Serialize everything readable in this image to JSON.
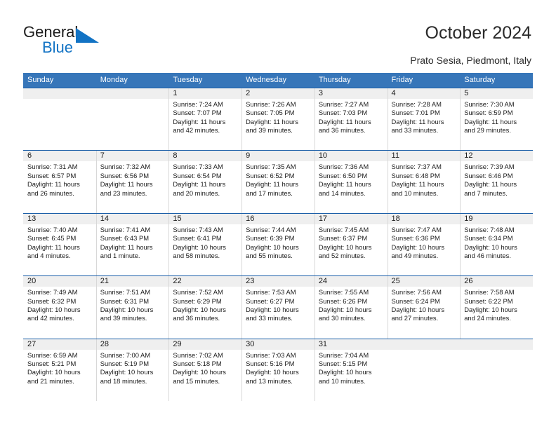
{
  "brand": {
    "word1": "General",
    "word2": "Blue",
    "triangle_color": "#1273c4",
    "text_color": "#1b1b1b"
  },
  "header": {
    "title": "October 2024",
    "subtitle": "Prato Sesia, Piedmont, Italy",
    "accent_color": "#3776b9",
    "rule_color": "#1a5ea8",
    "band_color": "#efefef"
  },
  "calendar": {
    "weekday_headers": [
      "Sunday",
      "Monday",
      "Tuesday",
      "Wednesday",
      "Thursday",
      "Friday",
      "Saturday"
    ],
    "weeks": [
      [
        {
          "day": "",
          "sunrise": "",
          "sunset": "",
          "daylight1": "",
          "daylight2": ""
        },
        {
          "day": "",
          "sunrise": "",
          "sunset": "",
          "daylight1": "",
          "daylight2": ""
        },
        {
          "day": "1",
          "sunrise": "Sunrise: 7:24 AM",
          "sunset": "Sunset: 7:07 PM",
          "daylight1": "Daylight: 11 hours",
          "daylight2": "and 42 minutes."
        },
        {
          "day": "2",
          "sunrise": "Sunrise: 7:26 AM",
          "sunset": "Sunset: 7:05 PM",
          "daylight1": "Daylight: 11 hours",
          "daylight2": "and 39 minutes."
        },
        {
          "day": "3",
          "sunrise": "Sunrise: 7:27 AM",
          "sunset": "Sunset: 7:03 PM",
          "daylight1": "Daylight: 11 hours",
          "daylight2": "and 36 minutes."
        },
        {
          "day": "4",
          "sunrise": "Sunrise: 7:28 AM",
          "sunset": "Sunset: 7:01 PM",
          "daylight1": "Daylight: 11 hours",
          "daylight2": "and 33 minutes."
        },
        {
          "day": "5",
          "sunrise": "Sunrise: 7:30 AM",
          "sunset": "Sunset: 6:59 PM",
          "daylight1": "Daylight: 11 hours",
          "daylight2": "and 29 minutes."
        }
      ],
      [
        {
          "day": "6",
          "sunrise": "Sunrise: 7:31 AM",
          "sunset": "Sunset: 6:57 PM",
          "daylight1": "Daylight: 11 hours",
          "daylight2": "and 26 minutes."
        },
        {
          "day": "7",
          "sunrise": "Sunrise: 7:32 AM",
          "sunset": "Sunset: 6:56 PM",
          "daylight1": "Daylight: 11 hours",
          "daylight2": "and 23 minutes."
        },
        {
          "day": "8",
          "sunrise": "Sunrise: 7:33 AM",
          "sunset": "Sunset: 6:54 PM",
          "daylight1": "Daylight: 11 hours",
          "daylight2": "and 20 minutes."
        },
        {
          "day": "9",
          "sunrise": "Sunrise: 7:35 AM",
          "sunset": "Sunset: 6:52 PM",
          "daylight1": "Daylight: 11 hours",
          "daylight2": "and 17 minutes."
        },
        {
          "day": "10",
          "sunrise": "Sunrise: 7:36 AM",
          "sunset": "Sunset: 6:50 PM",
          "daylight1": "Daylight: 11 hours",
          "daylight2": "and 14 minutes."
        },
        {
          "day": "11",
          "sunrise": "Sunrise: 7:37 AM",
          "sunset": "Sunset: 6:48 PM",
          "daylight1": "Daylight: 11 hours",
          "daylight2": "and 10 minutes."
        },
        {
          "day": "12",
          "sunrise": "Sunrise: 7:39 AM",
          "sunset": "Sunset: 6:46 PM",
          "daylight1": "Daylight: 11 hours",
          "daylight2": "and 7 minutes."
        }
      ],
      [
        {
          "day": "13",
          "sunrise": "Sunrise: 7:40 AM",
          "sunset": "Sunset: 6:45 PM",
          "daylight1": "Daylight: 11 hours",
          "daylight2": "and 4 minutes."
        },
        {
          "day": "14",
          "sunrise": "Sunrise: 7:41 AM",
          "sunset": "Sunset: 6:43 PM",
          "daylight1": "Daylight: 11 hours",
          "daylight2": "and 1 minute."
        },
        {
          "day": "15",
          "sunrise": "Sunrise: 7:43 AM",
          "sunset": "Sunset: 6:41 PM",
          "daylight1": "Daylight: 10 hours",
          "daylight2": "and 58 minutes."
        },
        {
          "day": "16",
          "sunrise": "Sunrise: 7:44 AM",
          "sunset": "Sunset: 6:39 PM",
          "daylight1": "Daylight: 10 hours",
          "daylight2": "and 55 minutes."
        },
        {
          "day": "17",
          "sunrise": "Sunrise: 7:45 AM",
          "sunset": "Sunset: 6:37 PM",
          "daylight1": "Daylight: 10 hours",
          "daylight2": "and 52 minutes."
        },
        {
          "day": "18",
          "sunrise": "Sunrise: 7:47 AM",
          "sunset": "Sunset: 6:36 PM",
          "daylight1": "Daylight: 10 hours",
          "daylight2": "and 49 minutes."
        },
        {
          "day": "19",
          "sunrise": "Sunrise: 7:48 AM",
          "sunset": "Sunset: 6:34 PM",
          "daylight1": "Daylight: 10 hours",
          "daylight2": "and 46 minutes."
        }
      ],
      [
        {
          "day": "20",
          "sunrise": "Sunrise: 7:49 AM",
          "sunset": "Sunset: 6:32 PM",
          "daylight1": "Daylight: 10 hours",
          "daylight2": "and 42 minutes."
        },
        {
          "day": "21",
          "sunrise": "Sunrise: 7:51 AM",
          "sunset": "Sunset: 6:31 PM",
          "daylight1": "Daylight: 10 hours",
          "daylight2": "and 39 minutes."
        },
        {
          "day": "22",
          "sunrise": "Sunrise: 7:52 AM",
          "sunset": "Sunset: 6:29 PM",
          "daylight1": "Daylight: 10 hours",
          "daylight2": "and 36 minutes."
        },
        {
          "day": "23",
          "sunrise": "Sunrise: 7:53 AM",
          "sunset": "Sunset: 6:27 PM",
          "daylight1": "Daylight: 10 hours",
          "daylight2": "and 33 minutes."
        },
        {
          "day": "24",
          "sunrise": "Sunrise: 7:55 AM",
          "sunset": "Sunset: 6:26 PM",
          "daylight1": "Daylight: 10 hours",
          "daylight2": "and 30 minutes."
        },
        {
          "day": "25",
          "sunrise": "Sunrise: 7:56 AM",
          "sunset": "Sunset: 6:24 PM",
          "daylight1": "Daylight: 10 hours",
          "daylight2": "and 27 minutes."
        },
        {
          "day": "26",
          "sunrise": "Sunrise: 7:58 AM",
          "sunset": "Sunset: 6:22 PM",
          "daylight1": "Daylight: 10 hours",
          "daylight2": "and 24 minutes."
        }
      ],
      [
        {
          "day": "27",
          "sunrise": "Sunrise: 6:59 AM",
          "sunset": "Sunset: 5:21 PM",
          "daylight1": "Daylight: 10 hours",
          "daylight2": "and 21 minutes."
        },
        {
          "day": "28",
          "sunrise": "Sunrise: 7:00 AM",
          "sunset": "Sunset: 5:19 PM",
          "daylight1": "Daylight: 10 hours",
          "daylight2": "and 18 minutes."
        },
        {
          "day": "29",
          "sunrise": "Sunrise: 7:02 AM",
          "sunset": "Sunset: 5:18 PM",
          "daylight1": "Daylight: 10 hours",
          "daylight2": "and 15 minutes."
        },
        {
          "day": "30",
          "sunrise": "Sunrise: 7:03 AM",
          "sunset": "Sunset: 5:16 PM",
          "daylight1": "Daylight: 10 hours",
          "daylight2": "and 13 minutes."
        },
        {
          "day": "31",
          "sunrise": "Sunrise: 7:04 AM",
          "sunset": "Sunset: 5:15 PM",
          "daylight1": "Daylight: 10 hours",
          "daylight2": "and 10 minutes."
        },
        {
          "day": "",
          "sunrise": "",
          "sunset": "",
          "daylight1": "",
          "daylight2": ""
        },
        {
          "day": "",
          "sunrise": "",
          "sunset": "",
          "daylight1": "",
          "daylight2": ""
        }
      ]
    ]
  }
}
